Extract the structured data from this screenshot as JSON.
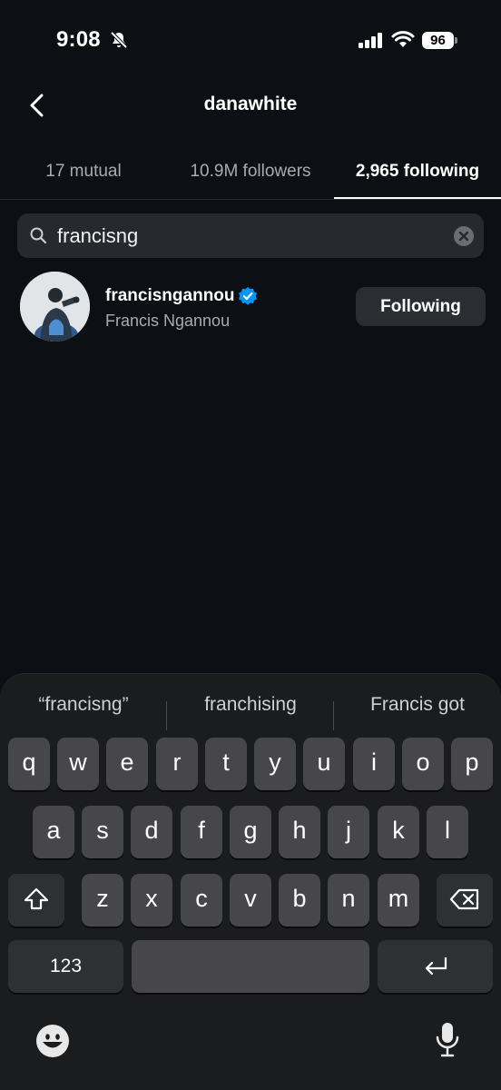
{
  "status_bar": {
    "time": "9:08",
    "battery": "96",
    "icons": [
      "bell-slash-icon",
      "cellular-signal-icon",
      "wifi-icon",
      "battery-icon"
    ]
  },
  "header": {
    "title": "danawhite",
    "back_icon": "chevron-left-icon"
  },
  "tabs": [
    {
      "label": "17 mutual",
      "active": false
    },
    {
      "label": "10.9M followers",
      "active": false
    },
    {
      "label": "2,965 following",
      "active": true
    }
  ],
  "search": {
    "value": "francisng",
    "icon": "search-icon",
    "clear_icon": "clear-circle-icon"
  },
  "results": [
    {
      "username": "francisngannou",
      "full_name": "Francis Ngannou",
      "verified": true,
      "button_label": "Following"
    }
  ],
  "keyboard": {
    "suggestions": [
      "“francisng”",
      "franchising",
      "Francis got"
    ],
    "row1": [
      "q",
      "w",
      "e",
      "r",
      "t",
      "y",
      "u",
      "i",
      "o",
      "p"
    ],
    "row2": [
      "a",
      "s",
      "d",
      "f",
      "g",
      "h",
      "j",
      "k",
      "l"
    ],
    "row3": [
      "z",
      "x",
      "c",
      "v",
      "b",
      "n",
      "m"
    ],
    "numbers_label": "123",
    "icons": [
      "shift-icon",
      "delete-icon",
      "return-icon",
      "emoji-icon",
      "microphone-icon"
    ]
  },
  "colors": {
    "background": "#0c1014",
    "surface": "#262a2f",
    "verified_blue": "#0095f6",
    "key": "#474749",
    "key_function": "#2f3032"
  }
}
